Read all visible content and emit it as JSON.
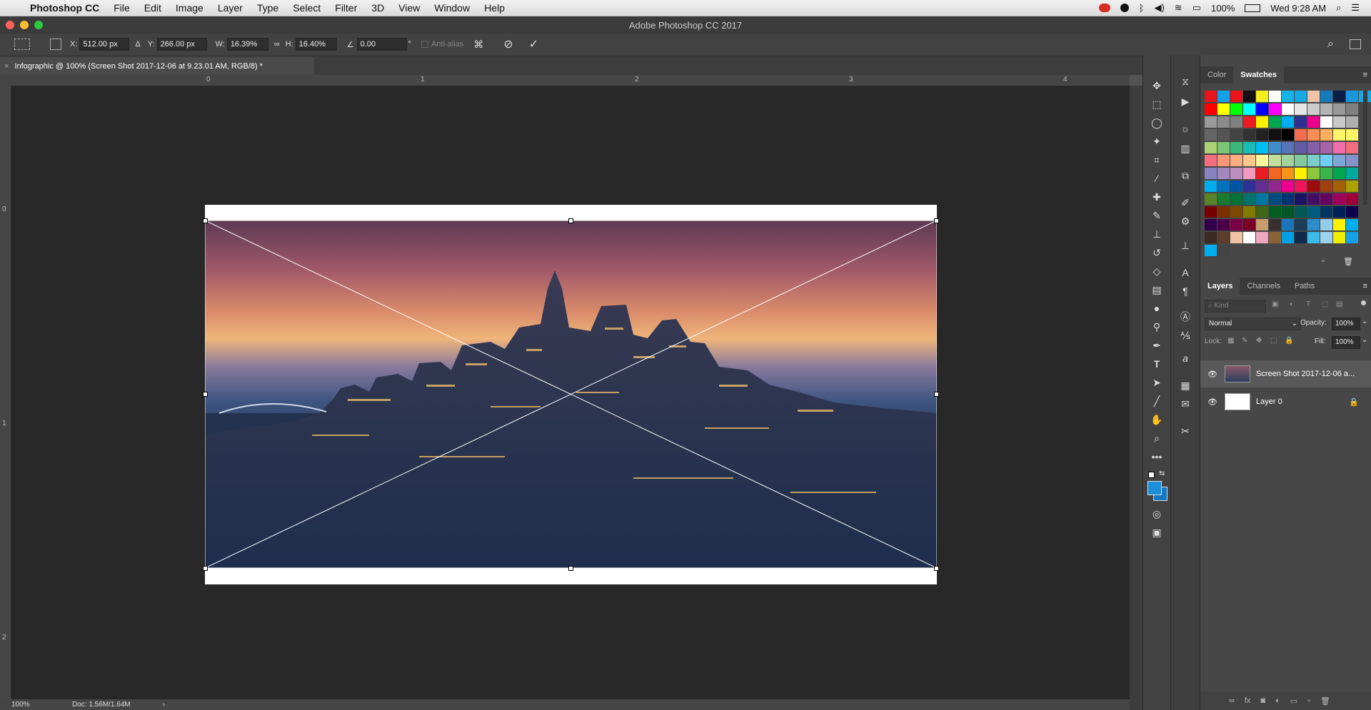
{
  "menubar": {
    "items": [
      "Photoshop CC",
      "File",
      "Edit",
      "Image",
      "Layer",
      "Type",
      "Select",
      "Filter",
      "3D",
      "View",
      "Window",
      "Help"
    ],
    "battery": "100%",
    "clock": "Wed 9:28 AM"
  },
  "window": {
    "title": "Adobe Photoshop CC 2017"
  },
  "options": {
    "x_label": "X:",
    "x_value": "512.00 px",
    "y_label": "Y:",
    "y_value": "266.00 px",
    "w_label": "W:",
    "w_value": "16.39%",
    "h_label": "H:",
    "h_value": "16.40%",
    "angle_value": "0.00",
    "degree": "°",
    "antialias_label": "Anti-alias"
  },
  "document": {
    "tab_title": "Infographic @ 100% (Screen Shot 2017-12-06 at 9.23.01 AM, RGB/8) *",
    "close": "×",
    "zoom": "100%",
    "doc_size": "Doc: 1.56M/1.64M",
    "ruler_h": [
      "0",
      "1",
      "2",
      "3",
      "4"
    ],
    "ruler_v": [
      "0",
      "1",
      "2"
    ]
  },
  "color_panel": {
    "tabs": [
      "Color",
      "Swatches"
    ],
    "active": "Swatches",
    "swatches": [
      [
        "#e8131b",
        "#13a2e8",
        "#e8131b",
        "#111111",
        "#f4ee1f",
        "#ffffff",
        "#16b4e8",
        "#15a9e6",
        "#f2c4a6",
        "#167bbd",
        "#0a1e44",
        "#1c97da",
        "#18a6e2"
      ],
      [
        "#ff0000",
        "#ffff00",
        "#00ff00",
        "#00ffff",
        "#0000ff",
        "#ff00ff",
        "#ffffff",
        "#e6e6e6",
        "#cccccc",
        "#b3b3b3",
        "#999999",
        "#808080"
      ],
      [
        "#999999",
        "#8a8a8a",
        "#808080",
        "#ed1c24",
        "#fff200",
        "#00a651",
        "#00aeef",
        "#2e3192",
        "#ec008c",
        "#ffffff",
        "#c8c8c8",
        "#b0b0b0"
      ],
      [
        "#666666",
        "#555555",
        "#444444",
        "#333333",
        "#222222",
        "#111111",
        "#000000",
        "#f26c4f",
        "#f68e56",
        "#fbaf5d",
        "#fff568",
        "#fff568"
      ],
      [
        "#acd373",
        "#7cc576",
        "#3bb878",
        "#1abbb4",
        "#00bff3",
        "#438ccb",
        "#5574b9",
        "#605ca8",
        "#855fa8",
        "#a763a8",
        "#f06ea9",
        "#f26d7d"
      ],
      [
        "#f26d7d",
        "#f7977a",
        "#f9ad81",
        "#fdc68a",
        "#fff79a",
        "#c4df9b",
        "#a3d39c",
        "#82ca9d",
        "#7bcdc8",
        "#6ecff6",
        "#7ea7d8",
        "#8493ca"
      ],
      [
        "#8882be",
        "#a187be",
        "#bc8dbf",
        "#f49ac2",
        "#ed1c24",
        "#f26522",
        "#f7941d",
        "#fff200",
        "#8dc73f",
        "#39b54a",
        "#00a651",
        "#00a99d"
      ],
      [
        "#00aeef",
        "#0072bc",
        "#0054a6",
        "#2e3192",
        "#662d91",
        "#92278f",
        "#ec008c",
        "#ed145b",
        "#9e0b0f",
        "#a0410d",
        "#a36209",
        "#aba000"
      ],
      [
        "#598527",
        "#197b30",
        "#007236",
        "#00746b",
        "#0076a3",
        "#004b80",
        "#003471",
        "#1b1464",
        "#440e62",
        "#630460",
        "#9e005d",
        "#9e0039"
      ],
      [
        "#790000",
        "#7b2e00",
        "#7d4900",
        "#827b00",
        "#406618",
        "#005e20",
        "#005826",
        "#005952",
        "#005b7f",
        "#003663",
        "#002157",
        "#0d004c"
      ],
      [
        "#32004b",
        "#4b0049",
        "#7b0046",
        "#7a0026",
        "#c69c6d",
        "#362f2d",
        "#1b75bb",
        "#1b3f59",
        "#2b8dcb",
        "#94cde9",
        "#fff200",
        "#00aeef"
      ],
      [
        "#3a2a20",
        "#5c3e2c",
        "#f2c4a6",
        "#ffffff",
        "#f0a8c0",
        "#8c6239",
        "#00a0e6",
        "#0f2a4a",
        "#3abbe9",
        "#9cd2ee",
        "#eeee00",
        "#15a0e8"
      ],
      [
        "#00aeef",
        "#444444"
      ]
    ]
  },
  "layers_panel": {
    "tabs": [
      "Layers",
      "Channels",
      "Paths"
    ],
    "active": "Layers",
    "kind_placeholder": "Kind",
    "blend_mode": "Normal",
    "opacity_label": "Opacity:",
    "opacity_value": "100%",
    "lock_label": "Lock:",
    "fill_label": "Fill:",
    "fill_value": "100%",
    "layers": [
      {
        "name": "Screen Shot 2017-12-06 a...",
        "selected": true
      },
      {
        "name": "Layer 0",
        "selected": false,
        "locked": true
      }
    ]
  },
  "colors": {
    "foreground": "#1b8fd8",
    "background": "#1478c4"
  }
}
